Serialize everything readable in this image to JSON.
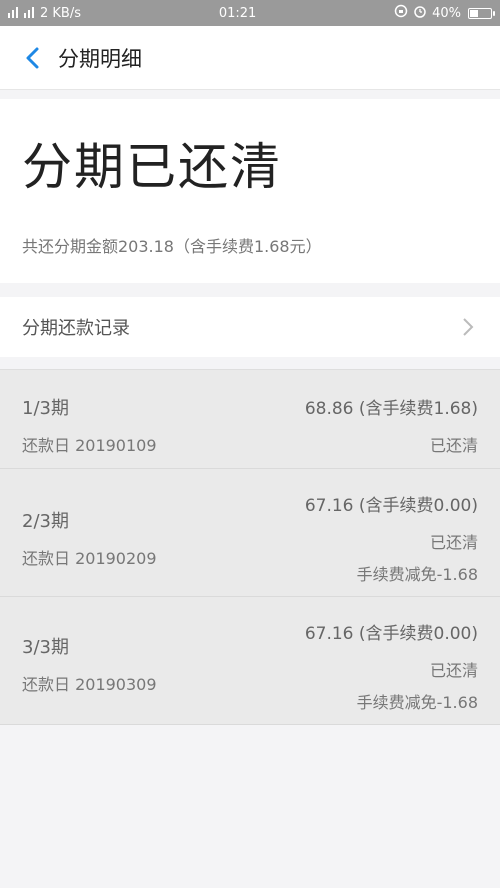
{
  "status_bar": {
    "signal": "",
    "carrier": "",
    "speed": "2 KB/s",
    "time": "01:21",
    "battery": "40%",
    "battery_level": 0.4
  },
  "header": {
    "title": "分期明细"
  },
  "summary": {
    "title": "分期已还清",
    "subtitle": "共还分期金额203.18（含手续费1.68元）"
  },
  "record_link": {
    "label": "分期还款记录"
  },
  "installments": [
    {
      "period": "1/3期",
      "date": "还款日 20190109",
      "amount": "68.86 (含手续费1.68)",
      "status": "已还清",
      "waiver": ""
    },
    {
      "period": "2/3期",
      "date": "还款日 20190209",
      "amount": "67.16 (含手续费0.00)",
      "status": "已还清",
      "waiver": "手续费减免-1.68"
    },
    {
      "period": "3/3期",
      "date": "还款日 20190309",
      "amount": "67.16 (含手续费0.00)",
      "status": "已还清",
      "waiver": "手续费减免-1.68"
    }
  ]
}
